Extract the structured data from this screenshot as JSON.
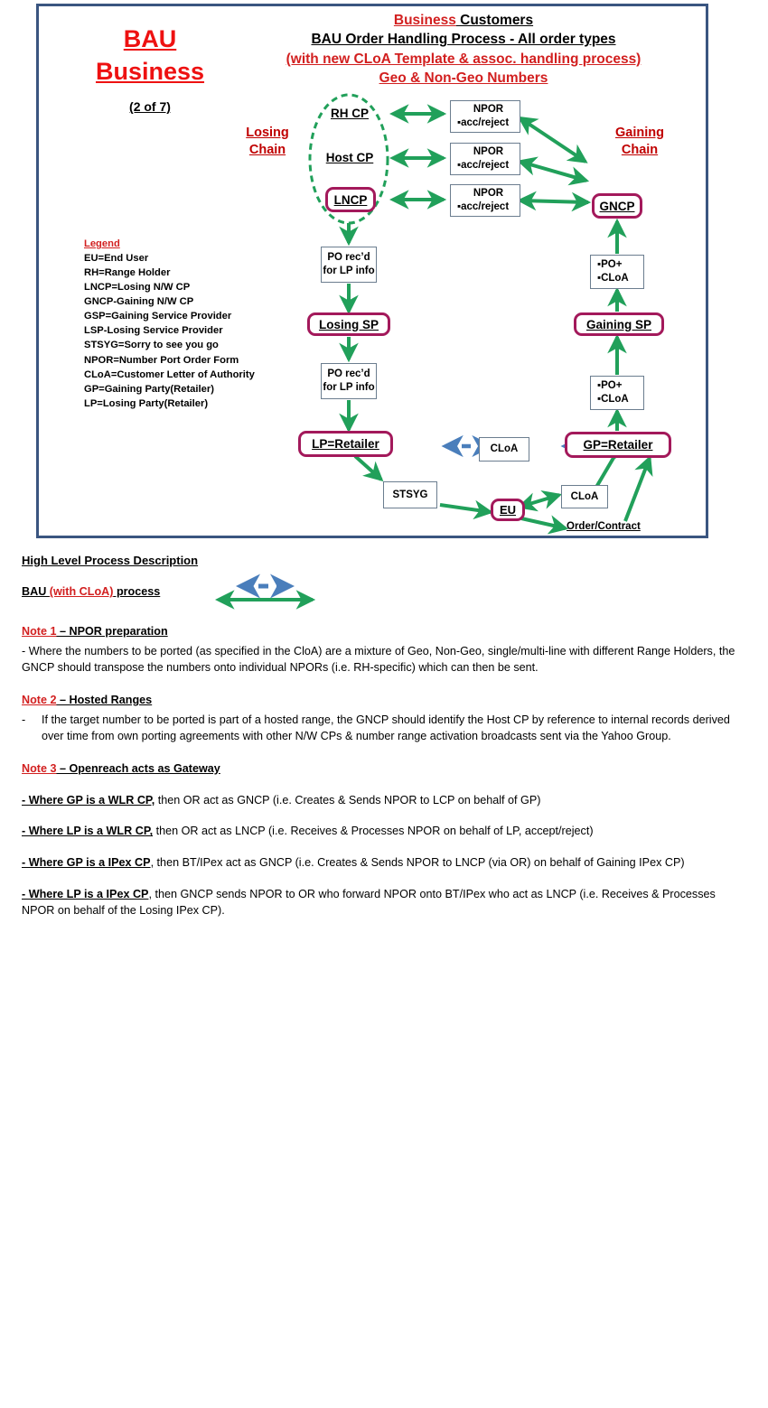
{
  "header": {
    "side_title_line1": "BAU",
    "side_title_line2": "Business",
    "side_subtitle": "(2 of 7)",
    "title_line1_a": "Business",
    "title_line1_b": " Customers",
    "title_line2": "BAU Order Handling Process - All order types",
    "title_line3": "(with new CLoA Template & assoc. handling process)",
    "title_line4": "Geo & Non-Geo Numbers"
  },
  "diagram": {
    "losing_chain_label": "Losing\nChain",
    "losing_chain_l1": "Losing",
    "losing_chain_l2": "Chain",
    "gaining_chain_l1": "Gaining",
    "gaining_chain_l2": "Chain",
    "rh_cp": "RH CP",
    "host_cp": "Host CP",
    "lncp": "LNCP",
    "gncp": "GNCP",
    "npor_title": "NPOR",
    "npor_sub": "▪acc/reject",
    "po_recd_l1": "PO rec’d",
    "po_recd_l2": "for LP info",
    "losing_sp": "Losing SP",
    "gaining_sp": "Gaining SP",
    "po_plus": "▪PO+",
    "cloa_bullet": "▪CLoA",
    "lp_retailer": "LP=Retailer",
    "gp_retailer": "GP=Retailer",
    "cloa": "CLoA",
    "stsyg": "STSYG",
    "eu": "EU",
    "order_contract": "Order/Contract"
  },
  "legend": {
    "title": "Legend",
    "items": [
      "EU=End User",
      "RH=Range Holder",
      "LNCP=Losing N/W CP",
      "GNCP-Gaining N/W CP",
      "GSP=Gaining Service Provider",
      "LSP-Losing Service Provider",
      "STSYG=Sorry to see you go",
      "NPOR=Number Port Order Form",
      "CLoA=Customer Letter of Authority",
      "GP=Gaining Party(Retailer)",
      "LP=Losing Party(Retailer)"
    ]
  },
  "notes": {
    "section_title": "High Level Process Description",
    "bau_legend_a": "BAU ",
    "bau_legend_b": "(with CLoA)",
    "bau_legend_c": " process",
    "note1_title_a": "Note 1",
    "note1_title_b": " – NPOR preparation",
    "note1_body": "- Where the numbers to be ported (as specified in the CloA) are a mixture of Geo, Non-Geo, single/multi-line with different Range Holders, the GNCP should transpose the numbers onto individual NPORs (i.e. RH-specific) which can then be sent.",
    "note2_title_a": "Note 2",
    "note2_title_b": " – Hosted Ranges",
    "note2_bullet": "-",
    "note2_body": "If the target number to be ported is part of a hosted range, the GNCP should identify the Host CP by reference to internal records derived over time from own porting agreements with other N/W CPs & number range activation broadcasts sent via the Yahoo Group.",
    "note3_title_a": "Note 3",
    "note3_title_b": " – Openreach acts as Gateway",
    "note3_items": [
      {
        "lead": " - Where GP is a WLR CP,",
        "rest": " then OR act as GNCP (i.e. Creates & Sends NPOR to LCP on behalf of GP)"
      },
      {
        "lead": " - Where LP is a WLR CP,",
        "rest": " then OR act as LNCP (i.e. Receives & Processes NPOR on behalf of LP, accept/reject)"
      },
      {
        "lead": " - Where GP is a IPex CP",
        "rest": ", then BT/IPex act as GNCP (i.e. Creates & Sends NPOR to LNCP (via OR) on behalf of Gaining IPex CP)"
      },
      {
        "lead": "- Where LP is a IPex CP",
        "rest": ", then GNCP sends NPOR to OR who forward NPOR onto BT/IPex who act as LNCP (i.e. Receives & Processes NPOR on behalf of the Losing IPex CP)."
      }
    ]
  },
  "colors": {
    "frame_border": "#3a5580",
    "red": "#d21f1f",
    "bright_red": "#ee1111",
    "green_arrow": "#21a05a",
    "blue_arrow": "#4a7ebb",
    "magenta_border": "#a3195b",
    "box_border": "#6b7d8f"
  }
}
